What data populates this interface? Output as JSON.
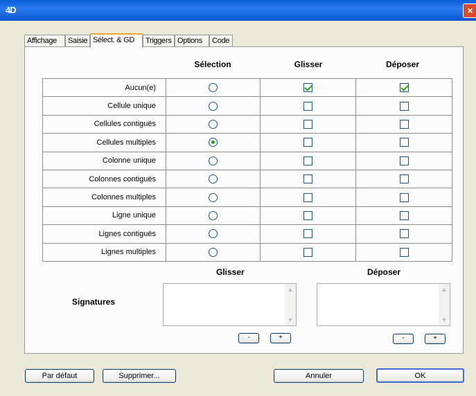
{
  "window": {
    "icon": "4D",
    "close_icon": "×"
  },
  "tabs": [
    "Affichage",
    "Saisie",
    "Sélect. & GD",
    "Triggers",
    "Options",
    "Code"
  ],
  "active_tab": 2,
  "grid": {
    "headers": {
      "selection": "Sélection",
      "glisser": "Glisser",
      "deposer": "Déposer"
    },
    "rows": [
      {
        "label": "Aucun(e)",
        "selected": false,
        "glisser": true,
        "deposer": true
      },
      {
        "label": "Cellule unique",
        "selected": false,
        "glisser": false,
        "deposer": false
      },
      {
        "label": "Cellules contiguës",
        "selected": false,
        "glisser": false,
        "deposer": false
      },
      {
        "label": "Cellules multiples",
        "selected": true,
        "glisser": false,
        "deposer": false
      },
      {
        "label": "Colonne unique",
        "selected": false,
        "glisser": false,
        "deposer": false
      },
      {
        "label": "Colonnes contiguës",
        "selected": false,
        "glisser": false,
        "deposer": false
      },
      {
        "label": "Colonnes multiples",
        "selected": false,
        "glisser": false,
        "deposer": false
      },
      {
        "label": "Ligne unique",
        "selected": false,
        "glisser": false,
        "deposer": false
      },
      {
        "label": "Lignes contiguës",
        "selected": false,
        "glisser": false,
        "deposer": false
      },
      {
        "label": "Lignes multiples",
        "selected": false,
        "glisser": false,
        "deposer": false
      }
    ]
  },
  "signatures": {
    "label": "Signatures",
    "glisser_head": "Glisser",
    "deposer_head": "Déposer",
    "remove_label": "-",
    "add_label": "+"
  },
  "footer": {
    "default_label": "Par défaut",
    "delete_label": "Supprimer...",
    "cancel_label": "Annuler",
    "ok_label": "OK"
  }
}
